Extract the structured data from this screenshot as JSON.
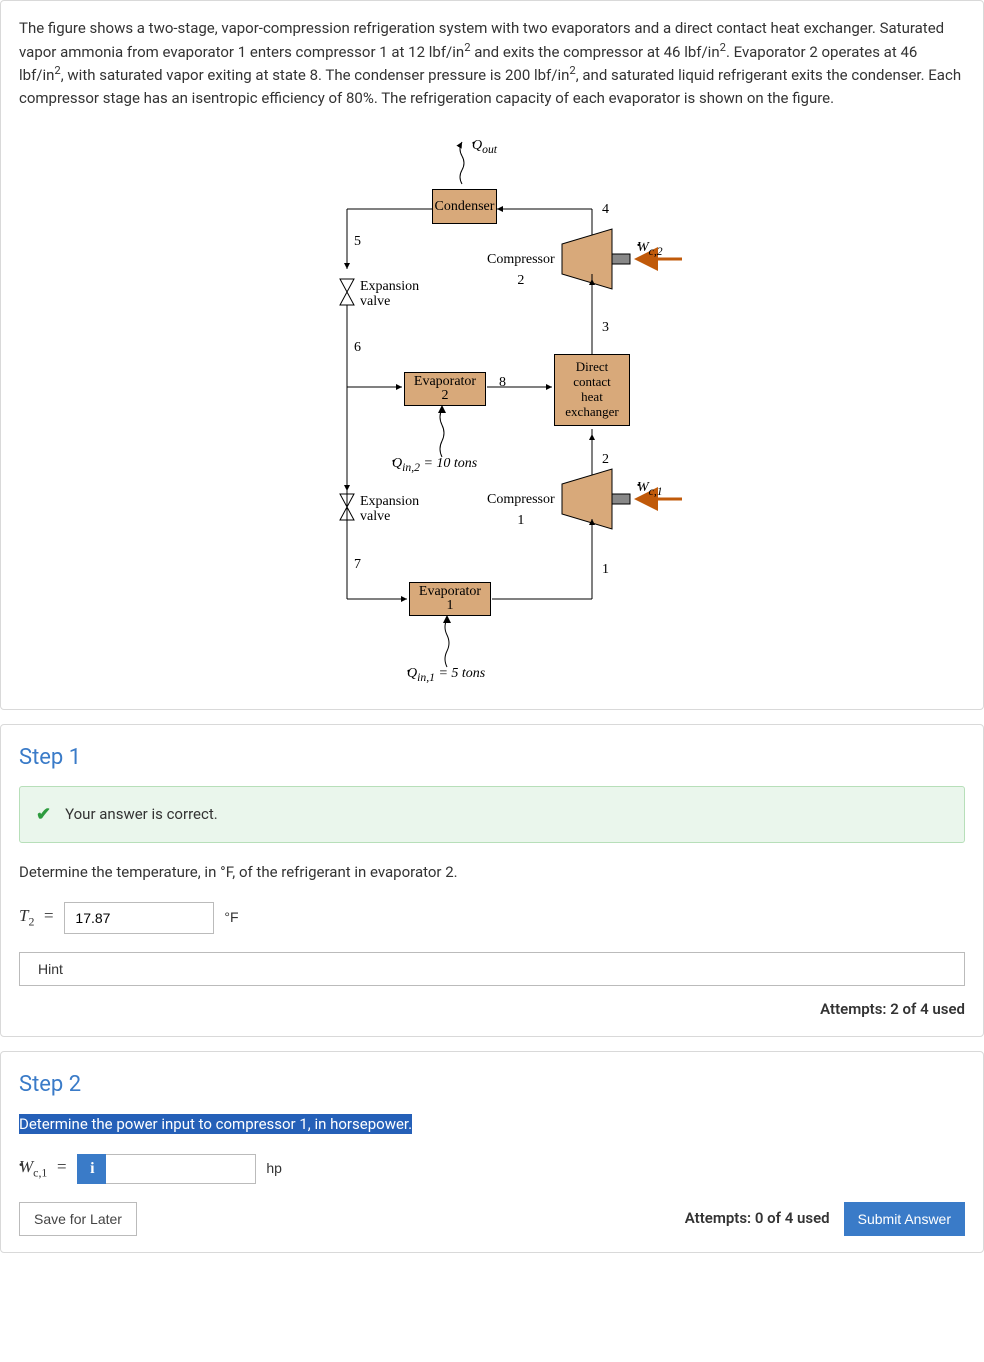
{
  "problem": {
    "text": "The figure shows a two-stage, vapor-compression refrigeration system with two evaporators and a direct contact heat exchanger. Saturated vapor ammonia from evaporator 1 enters compressor 1 at 12 lbf/in² and exits the compressor at 46 lbf/in². Evaporator 2 operates at 46 lbf/in², with saturated vapor exiting at state 8. The condenser pressure is 200 lbf/in², and saturated liquid refrigerant exits the condenser. Each compressor stage has an isentropic efficiency of 80%. The refrigeration capacity of each evaporator is shown on the figure."
  },
  "figure": {
    "qout": "Q̇out",
    "condenser": "Condenser",
    "state5": "5",
    "state4": "4",
    "exp_valve": "Expansion valve",
    "state6": "6",
    "evap2": "Evaporator 2",
    "state8": "8",
    "dche": "Direct contact heat exchanger",
    "qin2": "Q̇in,2 = 10 tons",
    "state3": "3",
    "state2": "2",
    "compressor2": "Compressor 2",
    "wc2": "Ẇc,2",
    "compressor1": "Compressor 1",
    "wc1": "Ẇc,1",
    "state7": "7",
    "evap1": "Evaporator 1",
    "state1": "1",
    "qin1": "Q̇in,1 = 5 tons"
  },
  "step1": {
    "title": "Step 1",
    "alert": "Your answer is correct.",
    "question": "Determine the temperature, in °F, of the refrigerant in evaporator 2.",
    "var": "T₂ =",
    "value": "17.87",
    "unit": "°F",
    "hint": "Hint",
    "attempts": "Attempts: 2 of 4 used"
  },
  "step2": {
    "title": "Step 2",
    "question": "Determine the power input to compressor 1, in horsepower.",
    "var": "Ẇc,1 =",
    "unit": "hp",
    "save": "Save for Later",
    "attempts": "Attempts: 0 of 4 used",
    "submit": "Submit Answer"
  }
}
